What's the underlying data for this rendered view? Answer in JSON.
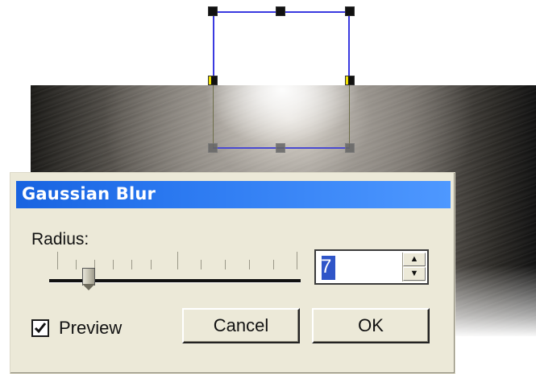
{
  "dialog": {
    "title": "Gaussian Blur",
    "radius_label": "Radius:",
    "radius_value": "7",
    "preview_label": "Preview",
    "preview_checked": true,
    "cancel_label": "Cancel",
    "ok_label": "OK"
  },
  "icons": {
    "spin_up": "chevron-up-icon",
    "spin_down": "chevron-down-icon",
    "checkmark": "checkmark-icon"
  },
  "colors": {
    "titlebar": "#2a78f0",
    "selection_frame": "#3a3ae0",
    "dialog_bg": "#ece9d8"
  }
}
